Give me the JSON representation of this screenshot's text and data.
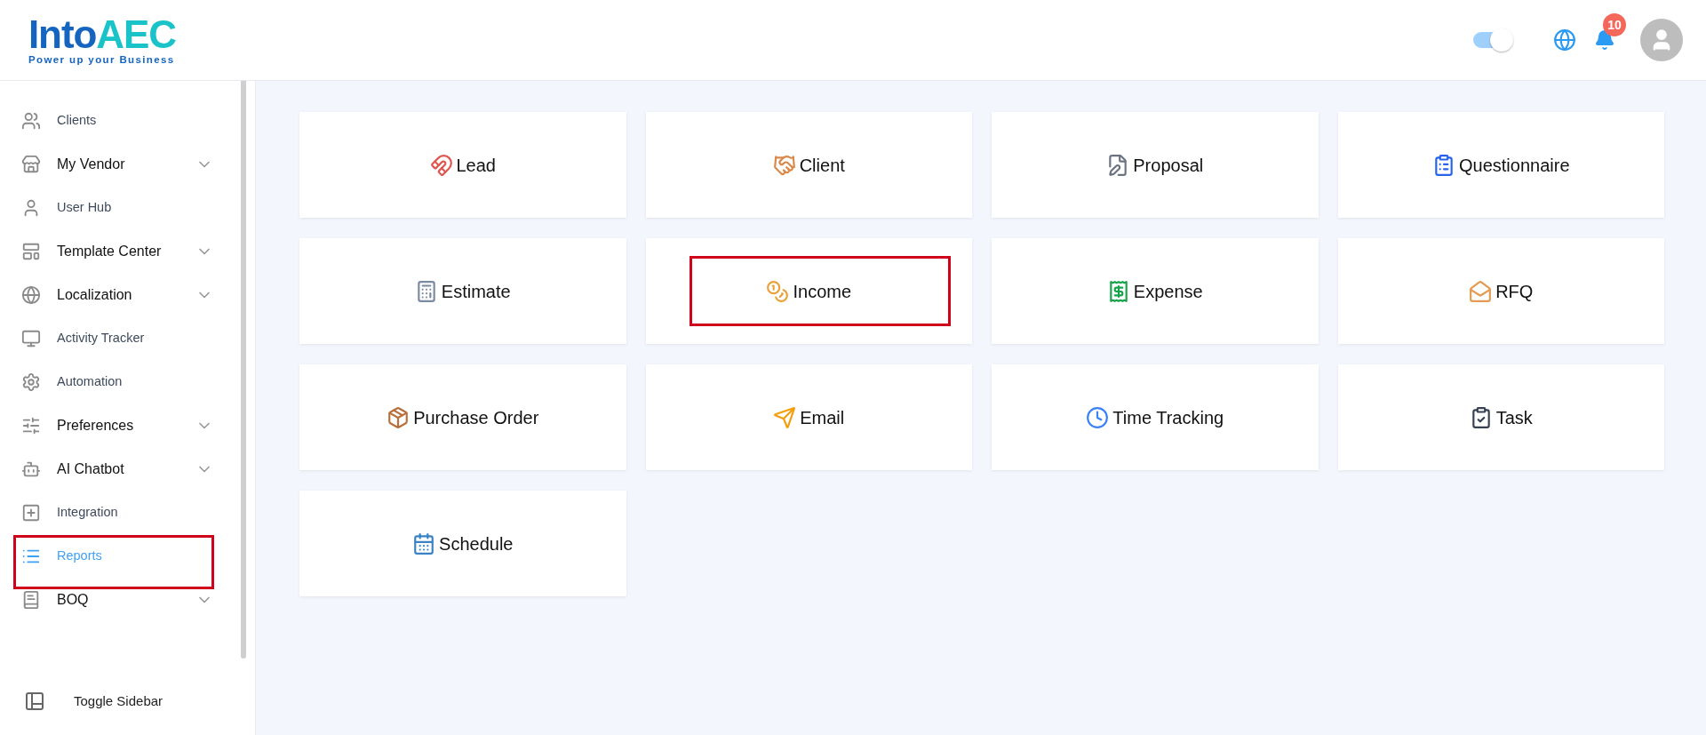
{
  "logo": {
    "word": "Into",
    "mark": "AEC",
    "tagline": "Power up your Business"
  },
  "header": {
    "theme_toggle": {
      "on": true
    },
    "notifications": {
      "count": "10"
    }
  },
  "sidebar": {
    "items": [
      {
        "label": "Clients",
        "expandable": false,
        "selected": false,
        "highlighted": false
      },
      {
        "label": "My Vendor",
        "expandable": true,
        "selected": false,
        "highlighted": false
      },
      {
        "label": "User Hub",
        "expandable": false,
        "selected": false,
        "highlighted": false
      },
      {
        "label": "Template Center",
        "expandable": true,
        "selected": false,
        "highlighted": false
      },
      {
        "label": "Localization",
        "expandable": true,
        "selected": false,
        "highlighted": false
      },
      {
        "label": "Activity Tracker",
        "expandable": false,
        "selected": false,
        "highlighted": false
      },
      {
        "label": "Automation",
        "expandable": false,
        "selected": false,
        "highlighted": false
      },
      {
        "label": "Preferences",
        "expandable": true,
        "selected": false,
        "highlighted": false
      },
      {
        "label": "AI Chatbot",
        "expandable": true,
        "selected": false,
        "highlighted": false
      },
      {
        "label": "Integration",
        "expandable": false,
        "selected": false,
        "highlighted": false
      },
      {
        "label": "Reports",
        "expandable": false,
        "selected": true,
        "highlighted": true
      },
      {
        "label": "BOQ",
        "expandable": true,
        "selected": false,
        "highlighted": false
      }
    ],
    "footer": "Toggle Sidebar"
  },
  "reports": [
    {
      "label": "Lead",
      "highlighted": false
    },
    {
      "label": "Client",
      "highlighted": false
    },
    {
      "label": "Proposal",
      "highlighted": false
    },
    {
      "label": "Questionnaire",
      "highlighted": false
    },
    {
      "label": "Estimate",
      "highlighted": false
    },
    {
      "label": "Income",
      "highlighted": true
    },
    {
      "label": "Expense",
      "highlighted": false
    },
    {
      "label": "RFQ",
      "highlighted": false
    },
    {
      "label": "Purchase Order",
      "highlighted": false
    },
    {
      "label": "Email",
      "highlighted": false
    },
    {
      "label": "Time Tracking",
      "highlighted": false
    },
    {
      "label": "Task",
      "highlighted": false
    },
    {
      "label": "Schedule",
      "highlighted": false
    }
  ]
}
